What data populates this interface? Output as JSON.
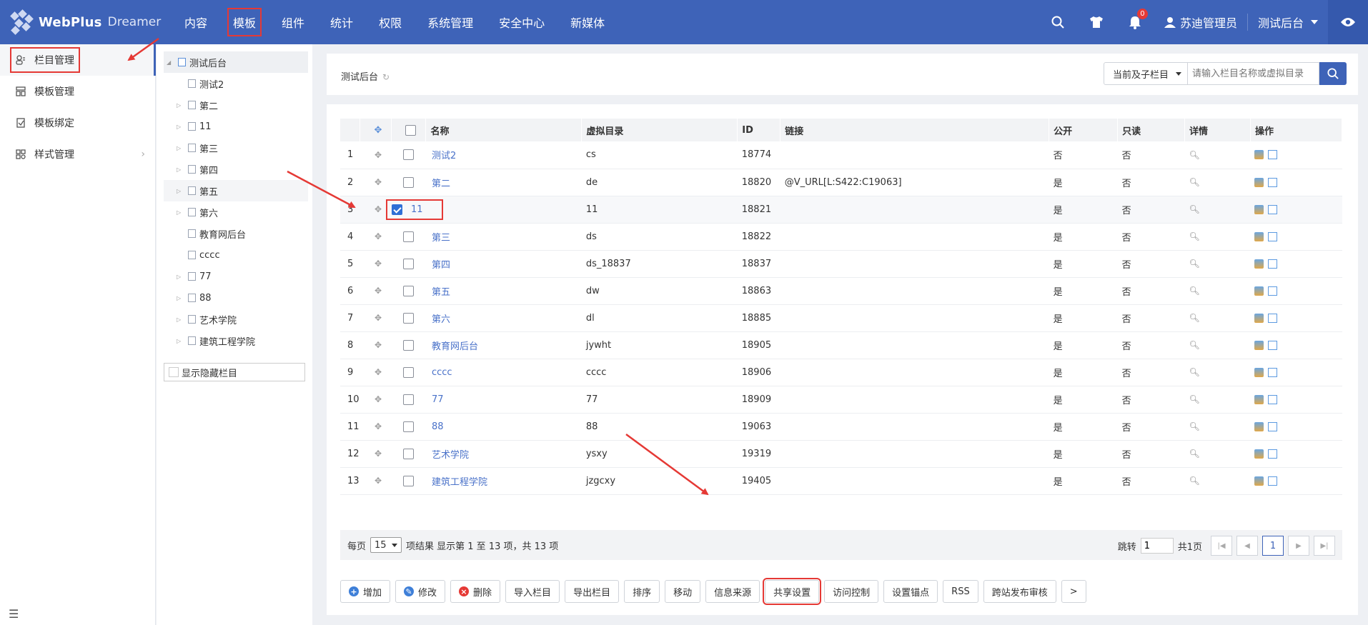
{
  "brand": {
    "name": "WebPlus",
    "product": "Dreamer"
  },
  "nav": [
    {
      "label": "内容"
    },
    {
      "label": "模板",
      "active": true
    },
    {
      "label": "组件"
    },
    {
      "label": "统计"
    },
    {
      "label": "权限"
    },
    {
      "label": "系统管理"
    },
    {
      "label": "安全中心"
    },
    {
      "label": "新媒体"
    }
  ],
  "header": {
    "notifications": "0",
    "user": "苏迪管理员",
    "site": "测试后台"
  },
  "sidebar": {
    "items": [
      {
        "label": "栏目管理",
        "icon": "users-icon",
        "active": true
      },
      {
        "label": "模板管理",
        "icon": "layout-icon"
      },
      {
        "label": "模板绑定",
        "icon": "bind-icon"
      },
      {
        "label": "样式管理",
        "icon": "grid-icon",
        "arrow": true
      }
    ]
  },
  "tree": {
    "root": "测试后台",
    "nodes": [
      {
        "label": "测试2",
        "toggle": false
      },
      {
        "label": "第二",
        "toggle": true
      },
      {
        "label": "11",
        "toggle": true
      },
      {
        "label": "第三",
        "toggle": true
      },
      {
        "label": "第四",
        "toggle": true
      },
      {
        "label": "第五",
        "toggle": true,
        "hl": true
      },
      {
        "label": "第六",
        "toggle": true
      },
      {
        "label": "教育网后台",
        "toggle": false
      },
      {
        "label": "cccc",
        "toggle": false
      },
      {
        "label": "77",
        "toggle": true
      },
      {
        "label": "88",
        "toggle": true
      },
      {
        "label": "艺术学院",
        "toggle": true
      },
      {
        "label": "建筑工程学院",
        "toggle": true
      }
    ],
    "show_hidden": "显示隐藏栏目"
  },
  "crumb": {
    "title": "测试后台"
  },
  "search": {
    "scope": "当前及子栏目",
    "placeholder": "请输入栏目名称或虚拟目录"
  },
  "table": {
    "headers": {
      "name": "名称",
      "vdir": "虚拟目录",
      "id": "ID",
      "link": "链接",
      "public": "公开",
      "readonly": "只读",
      "detail": "详情",
      "ops": "操作"
    },
    "rows": [
      {
        "n": "1",
        "name": "测试2",
        "vdir": "cs",
        "id": "18774",
        "link": "",
        "pub": "否",
        "ro": "否"
      },
      {
        "n": "2",
        "name": "第二",
        "vdir": "de",
        "id": "18820",
        "link": "@V_URL[L:S422:C19063]",
        "pub": "是",
        "ro": "否"
      },
      {
        "n": "3",
        "name": "11",
        "vdir": "11",
        "id": "18821",
        "link": "",
        "pub": "是",
        "ro": "否",
        "checked": true
      },
      {
        "n": "4",
        "name": "第三",
        "vdir": "ds",
        "id": "18822",
        "link": "",
        "pub": "是",
        "ro": "否"
      },
      {
        "n": "5",
        "name": "第四",
        "vdir": "ds_18837",
        "id": "18837",
        "link": "",
        "pub": "是",
        "ro": "否"
      },
      {
        "n": "6",
        "name": "第五",
        "vdir": "dw",
        "id": "18863",
        "link": "",
        "pub": "是",
        "ro": "否"
      },
      {
        "n": "7",
        "name": "第六",
        "vdir": "dl",
        "id": "18885",
        "link": "",
        "pub": "是",
        "ro": "否"
      },
      {
        "n": "8",
        "name": "教育网后台",
        "vdir": "jywht",
        "id": "18905",
        "link": "",
        "pub": "是",
        "ro": "否"
      },
      {
        "n": "9",
        "name": "cccc",
        "vdir": "cccc",
        "id": "18906",
        "link": "",
        "pub": "是",
        "ro": "否"
      },
      {
        "n": "10",
        "name": "77",
        "vdir": "77",
        "id": "18909",
        "link": "",
        "pub": "是",
        "ro": "否"
      },
      {
        "n": "11",
        "name": "88",
        "vdir": "88",
        "id": "19063",
        "link": "",
        "pub": "是",
        "ro": "否"
      },
      {
        "n": "12",
        "name": "艺术学院",
        "vdir": "ysxy",
        "id": "19319",
        "link": "",
        "pub": "是",
        "ro": "否"
      },
      {
        "n": "13",
        "name": "建筑工程学院",
        "vdir": "jzgcxy",
        "id": "19405",
        "link": "",
        "pub": "是",
        "ro": "否"
      }
    ]
  },
  "pager": {
    "per_page_label": "每页",
    "per_page": "15",
    "summary": "项结果 显示第 1 至 13 项，共 13 项",
    "jump_label": "跳转",
    "jump_value": "1",
    "total_pages": "共1页",
    "current": "1"
  },
  "actions": [
    {
      "label": "增加",
      "icon": "plus-icon",
      "color": "#3e7fd8",
      "glyph": "+"
    },
    {
      "label": "修改",
      "icon": "edit-icon",
      "color": "#3e7fd8",
      "glyph": "✎"
    },
    {
      "label": "删除",
      "icon": "delete-icon",
      "color": "#e53935",
      "glyph": "×"
    },
    {
      "label": "导入栏目"
    },
    {
      "label": "导出栏目"
    },
    {
      "label": "排序"
    },
    {
      "label": "移动"
    },
    {
      "label": "信息来源"
    },
    {
      "label": "共享设置",
      "hl": true
    },
    {
      "label": "访问控制"
    },
    {
      "label": "设置锚点"
    },
    {
      "label": "RSS"
    },
    {
      "label": "跨站发布审核"
    },
    {
      "label": ">"
    }
  ]
}
